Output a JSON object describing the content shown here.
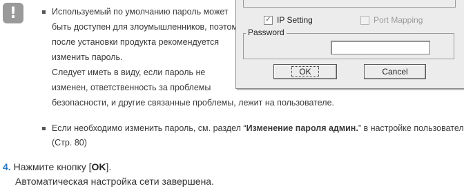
{
  "note": {
    "icon": "exclamation-icon",
    "bullet1_lines": [
      "Используемый по умолчанию пароль может",
      "быть доступен для злоумышленников, поэтому",
      "после установки продукта рекомендуется",
      "изменить пароль.",
      "Следует иметь в виду, если пароль не",
      "изменен, ответственность за проблемы",
      "безопасности, и другие связанные проблемы, лежит на пользователе."
    ],
    "bullet2_prefix": "Если необходимо изменить пароль, см. раздел “",
    "bullet2_bold": "Изменение пароля админ.",
    "bullet2_suffix": "” в настройке пользователя.",
    "bullet2_line2": "(Стр. 80)"
  },
  "dialog": {
    "ip_setting_label": "IP Setting",
    "ip_setting_checked": true,
    "port_mapping_label": "Port Mapping",
    "port_mapping_checked": false,
    "password_group_label": "Password",
    "password_value": "",
    "ok_label": "OK",
    "cancel_label": "Cancel"
  },
  "step": {
    "number": "4.",
    "text_prefix": "Нажмите кнопку [",
    "text_bold": "OK",
    "text_suffix": "].",
    "line2": "Автоматическая настройка сети завершена."
  }
}
